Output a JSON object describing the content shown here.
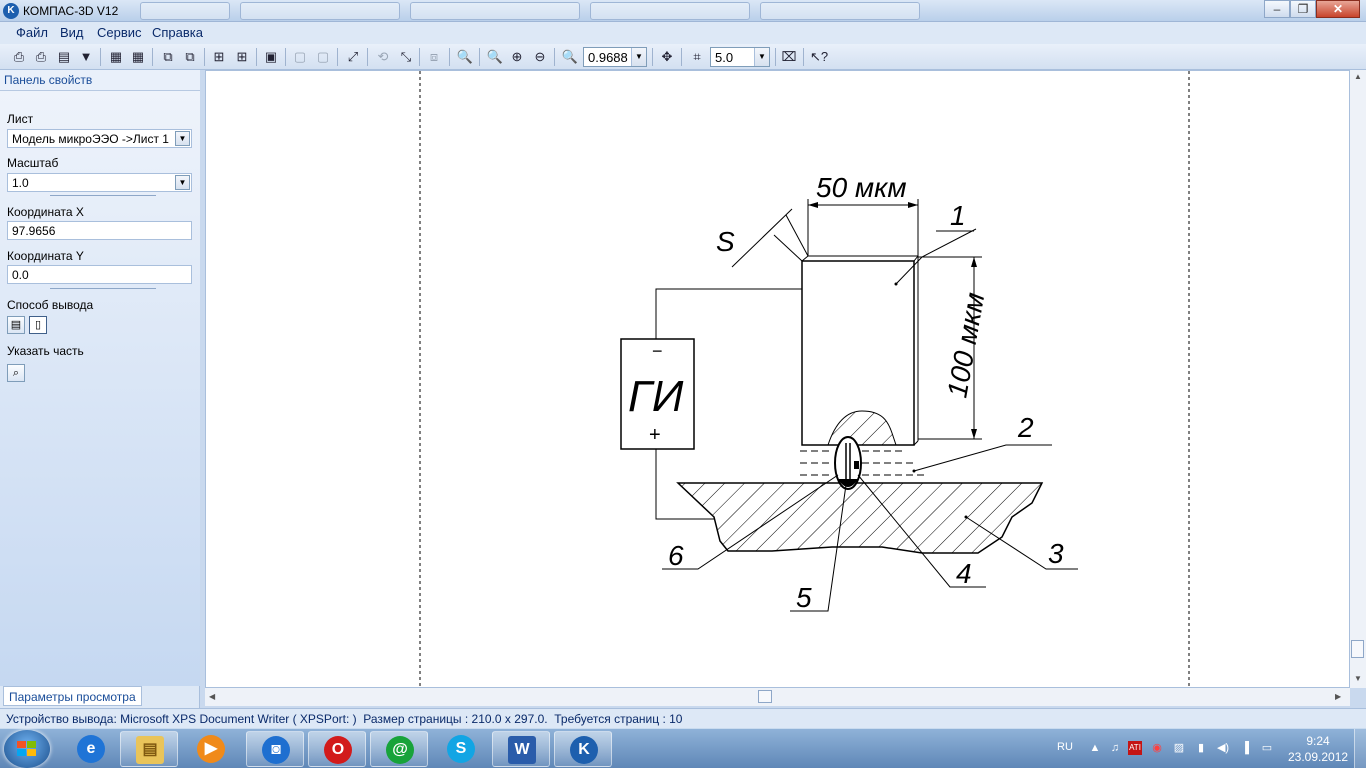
{
  "window": {
    "app_icon": "kompas-logo-icon",
    "title": "КОМПАС-3D V12",
    "controls": [
      "minimize-icon",
      "restore-icon",
      "close-icon"
    ]
  },
  "menu": {
    "items": [
      "Файл",
      "Вид",
      "Сервис",
      "Справка"
    ]
  },
  "toolbar": {
    "zoom_value": "0.9688",
    "step_value": "5.0"
  },
  "panel": {
    "header": "Панель свойств",
    "sheet_label": "Лист",
    "sheet_value": "Модель микроЭЭО ->Лист 1",
    "scale_label": "Масштаб",
    "scale_value": "1.0",
    "x_label": "Координата X",
    "x_value": "97.9656",
    "y_label": "Координата Y",
    "y_value": "0.0",
    "output_label": "Способ вывода",
    "part_label": "Указать часть",
    "tab_label": "Параметры просмотра"
  },
  "drawing": {
    "dim_top": "50 мкм",
    "dim_right": "100 мкм",
    "dim_gap": "S",
    "source_label": "ГИ",
    "minus": "−",
    "plus": "+",
    "callouts": [
      "1",
      "2",
      "3",
      "4",
      "5",
      "6"
    ]
  },
  "status": {
    "text": "Устройство вывода: Microsoft XPS Document Writer ( XPSPort: )  Размер страницы : 210.0 x 297.0.  Требуется страниц : 10"
  },
  "taskbar": {
    "apps": [
      "internet-explorer-icon",
      "file-explorer-icon",
      "media-player-icon",
      "metro-app-icon",
      "opera-icon",
      "mail-agent-icon",
      "skype-icon",
      "word-icon",
      "kompas-icon"
    ],
    "language": "RU",
    "time": "9:24",
    "date": "23.09.2012"
  },
  "colors": {
    "accent": "#1a4d99",
    "panel_bg": "#dde8f6",
    "taskbar": "#5f87b7"
  }
}
